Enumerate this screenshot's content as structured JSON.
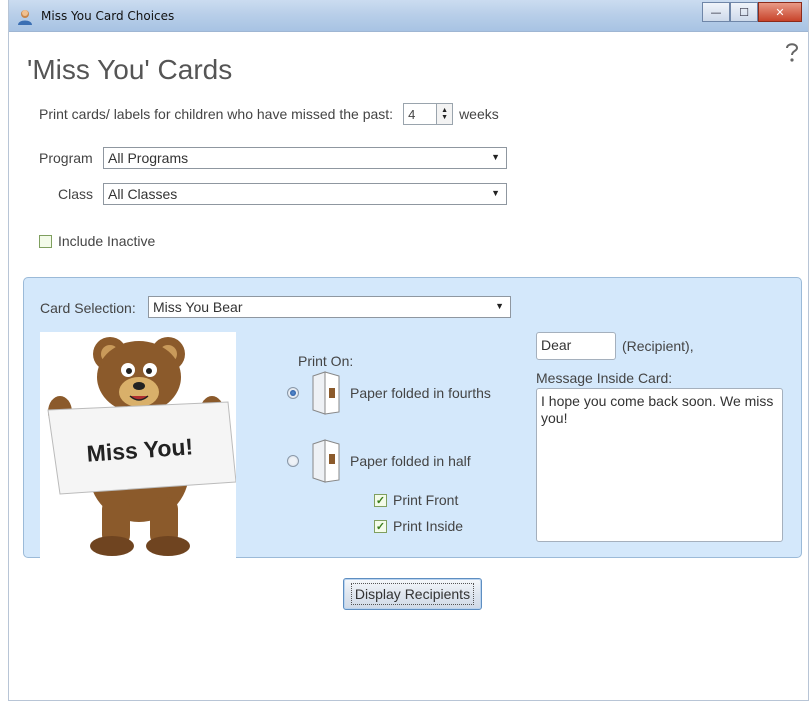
{
  "window": {
    "title": "Miss You Card Choices",
    "controls": {
      "minimize": "—",
      "maximize": "☐",
      "close": "✕"
    }
  },
  "page": {
    "title": "'Miss You' Cards"
  },
  "filters": {
    "missed_prefix": "Print cards/ labels for children who have missed the past:",
    "weeks_value": "4",
    "weeks_suffix": "weeks",
    "program_label": "Program",
    "program_value": "All Programs",
    "class_label": "Class",
    "class_value": "All Classes",
    "include_inactive_label": "Include Inactive",
    "include_inactive_checked": false
  },
  "card": {
    "selection_label": "Card Selection:",
    "selection_value": "Miss You Bear",
    "image_text": "Miss You!",
    "print_on_label": "Print On:",
    "options": [
      {
        "label": "Paper folded in fourths",
        "selected": true
      },
      {
        "label": "Paper folded in half",
        "selected": false
      }
    ],
    "print_front_label": "Print Front",
    "print_front_checked": true,
    "print_inside_label": "Print Inside",
    "print_inside_checked": true,
    "greeting_value": "Dear",
    "recipient_label": "(Recipient),",
    "message_label": "Message Inside Card:",
    "message_value": "I hope you come back soon.  We miss you!"
  },
  "actions": {
    "display_recipients": "Display Recipients"
  },
  "colors": {
    "panel_bg": "#d4e8fb",
    "checkbox_green": "#3a7d1c",
    "bear_brown": "#8b5a2b"
  }
}
